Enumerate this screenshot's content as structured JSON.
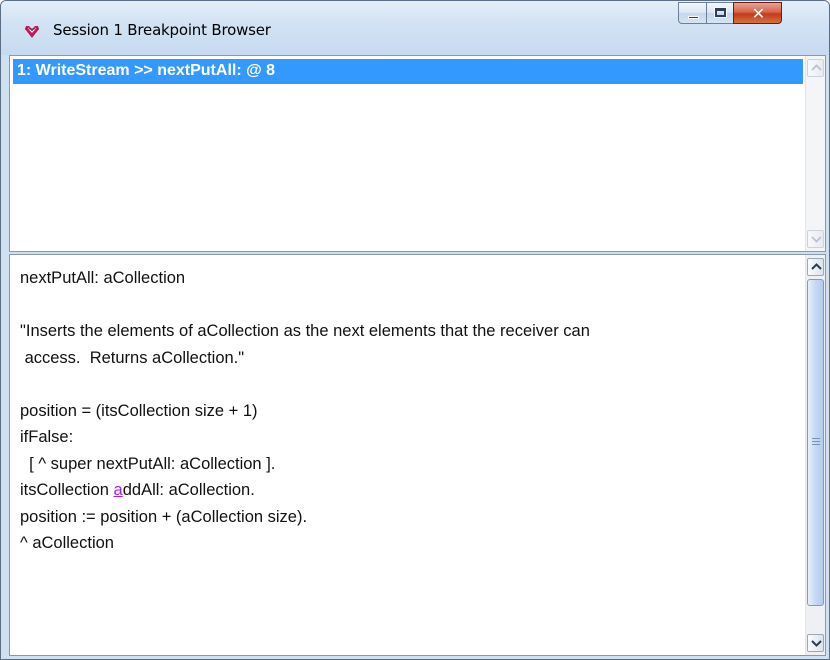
{
  "window": {
    "title": "Session 1 Breakpoint Browser"
  },
  "breakpoints": {
    "items": [
      {
        "label": "1: WriteStream >> nextPutAll: @ 8",
        "selected": true
      }
    ]
  },
  "source": {
    "lines": [
      "nextPutAll: aCollection",
      "",
      "\"Inserts the elements of aCollection as the next elements that the receiver can",
      " access.  Returns aCollection.\"",
      "",
      "position = (itsCollection size + 1)",
      "ifFalse:",
      "  [ ^ super nextPutAll: aCollection ].",
      "itsCollection addAll: aCollection.",
      "position := position + (aCollection size).",
      "^ aCollection"
    ],
    "breakpoint_marker": {
      "line_index": 8,
      "text_before": "itsCollection ",
      "marked_char": "a",
      "text_after": "ddAll: aCollection."
    }
  },
  "colors": {
    "selection": "#3399ff",
    "breakpoint_marker": "#a020f0"
  },
  "icons": [
    "gemstone-app-icon",
    "minimize-icon",
    "maximize-icon",
    "close-icon",
    "scroll-up-arrow-icon",
    "scroll-down-arrow-icon"
  ]
}
